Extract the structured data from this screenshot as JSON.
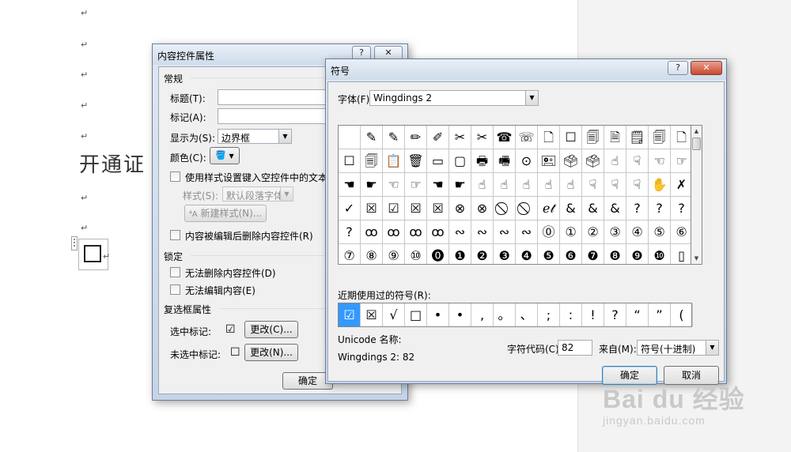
{
  "document": {
    "paragraph_mark": "↵",
    "heading": "开通证",
    "heading_tail": "¶"
  },
  "cc_dialog": {
    "title": "内容控件属性",
    "help": "?",
    "close": "✕",
    "general_group": "常规",
    "title_label": "标题(T):",
    "tag_label": "标记(A):",
    "show_as_label": "显示为(S):",
    "show_as_value": "边界框",
    "color_label": "颜色(C):",
    "use_style_label": "使用样式设置键入空控件中的文本格式",
    "style_label": "样式(S):",
    "style_value": "默认段落字体",
    "new_style_button": "新建样式(N)...",
    "remove_when_edited": "内容被编辑后删除内容控件(R)",
    "lock_group": "锁定",
    "cannot_delete": "无法删除内容控件(D)",
    "cannot_edit": "无法编辑内容(E)",
    "checkbox_group": "复选框属性",
    "checked_label": "选中标记:",
    "checked_symbol": "☑",
    "unchecked_label": "未选中标记:",
    "unchecked_symbol": "☐",
    "change_c": "更改(C)...",
    "change_n": "更改(N)...",
    "ok": "确定"
  },
  "symbol_dialog": {
    "title": "符号",
    "help": "?",
    "close": "✕",
    "font_label": "字体(F):",
    "font_value": "Wingdings 2",
    "grid_symbols": [
      "",
      "✎",
      "✎",
      "✏",
      "✐",
      "✂",
      "✂",
      "☎",
      "☏",
      "🗋",
      "☐",
      "🗐",
      "🗎",
      "🗒",
      "🗐",
      "🗋",
      "☐",
      "🗐",
      "📋",
      "🗑",
      "▭",
      "▢",
      "🖶",
      "🖷",
      "⊙",
      "🖭",
      "🗳",
      "🗳",
      "☝",
      "☟",
      "☜",
      "☞",
      "☚",
      "☛",
      "☜",
      "☞",
      "☚",
      "☛",
      "☝",
      "☝",
      "☝",
      "☝",
      "☝",
      "☟",
      "☟",
      "☟",
      "✋",
      "✗",
      "✓",
      "☒",
      "☑",
      "☒",
      "☒",
      "⊗",
      "⊗",
      "⃠",
      "⃠",
      "ℯ𝓉",
      "&",
      "&",
      "&",
      "?",
      "?",
      "?",
      "?",
      "ꝏ",
      "ꝏ",
      "ꝏ",
      "ꝏ",
      "∾",
      "∾",
      "∾",
      "∾",
      "⓪",
      "①",
      "②",
      "③",
      "④",
      "⑤",
      "⑥",
      "⑦",
      "⑧",
      "⑨",
      "⑩",
      "⓿",
      "❶",
      "❷",
      "❸",
      "❹",
      "❺",
      "❻",
      "❼",
      "❽",
      "❾",
      "❿",
      "▯"
    ],
    "recent_label": "近期使用过的符号(R):",
    "recent_symbols": [
      "☑",
      "☒",
      "√",
      "□",
      "•",
      "•",
      ",",
      "。",
      "、",
      ";",
      ":",
      "!",
      "?",
      "“",
      "”",
      "("
    ],
    "unicode_name_label": "Unicode 名称:",
    "unicode_name_value": "Wingdings 2: 82",
    "char_code_label": "字符代码(C):",
    "char_code_value": "82",
    "from_label": "来自(M):",
    "from_value": "符号(十进制)",
    "ok": "确定",
    "cancel": "取消"
  },
  "watermark": {
    "brand": "Bai du 经验",
    "url": "jingyan.baidu.com"
  }
}
